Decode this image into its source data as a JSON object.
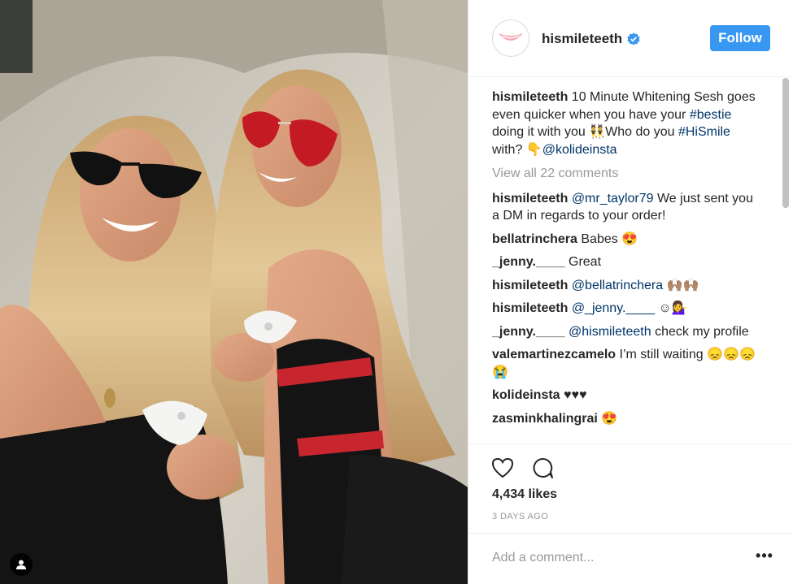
{
  "post": {
    "username": "hismileteeth",
    "follow_label": "Follow",
    "caption": {
      "user": "hismileteeth",
      "text1": " 10 Minute Whitening Sesh goes even quicker when you have your ",
      "tag1": "#bestie",
      "text2": " doing it with you 👯Who do you ",
      "tag2": "#HiSmile",
      "text3": " with? 👇",
      "mention": "@kolideinsta"
    },
    "view_all": "View all 22 comments",
    "comments": [
      {
        "user": "hismileteeth",
        "mention": "@mr_taylor79",
        "text": " We just sent you a DM in regards to your order!"
      },
      {
        "user": "bellatrinchera",
        "mention": "",
        "text": " Babes 😍"
      },
      {
        "user": "_jenny.____",
        "mention": "",
        "text": " Great"
      },
      {
        "user": "hismileteeth",
        "mention": "@bellatrinchera",
        "text": " 🙌🏽🙌🏽"
      },
      {
        "user": "hismileteeth",
        "mention": "@_jenny.____",
        "text": " ☺💁‍♀️"
      },
      {
        "user": "_jenny.____",
        "mention": "@hismileteeth",
        "text": " check my profile"
      },
      {
        "user": "valemartinezcamelo",
        "mention": "",
        "text": " I’m still waiting 😞😞😞😭"
      },
      {
        "user": "kolideinsta",
        "mention": "",
        "text": " ♥♥♥"
      },
      {
        "user": "zasminkhalingrai",
        "mention": "",
        "text": " 😍"
      }
    ],
    "likes": "4,434 likes",
    "date": "3 DAYS AGO",
    "add_comment_placeholder": "Add a comment...",
    "more_label": "•••"
  },
  "colors": {
    "follow_bg": "#3897f0",
    "link": "#003569",
    "muted": "#999999",
    "text": "#262626"
  },
  "icons": {
    "avatar": "smile-logo-icon",
    "verified": "verified-badge-icon",
    "like": "heart-icon",
    "comment": "comment-bubble-icon",
    "tag": "user-tag-icon",
    "more": "more-options-icon"
  }
}
